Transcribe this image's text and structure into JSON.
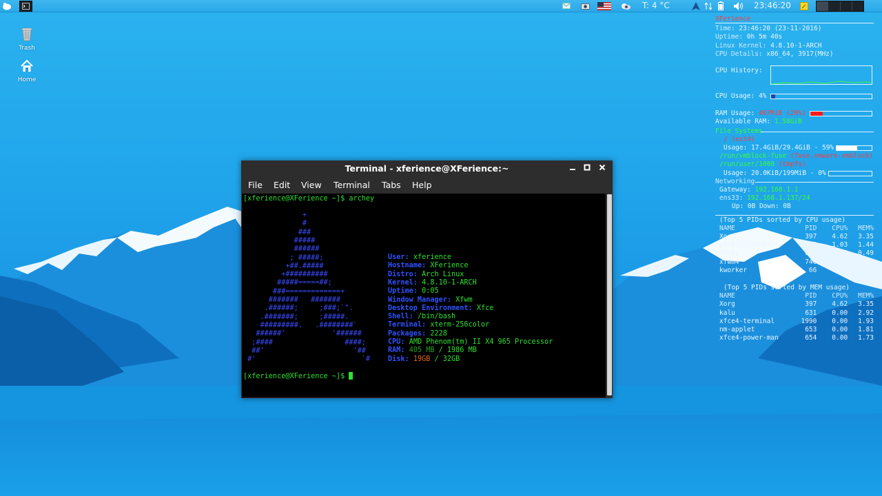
{
  "panel": {
    "temperature": "T: 4 °C",
    "clock": "23:46:20"
  },
  "desktop": {
    "icons": [
      {
        "label": "Trash",
        "icon": "trash-icon"
      },
      {
        "label": "Home",
        "icon": "home-icon"
      }
    ]
  },
  "conky": {
    "header": "XFerience",
    "time_label": "Time:",
    "time_value": "23:46:20 (23-11-2016)",
    "uptime_label": "Uptime:",
    "uptime_value": "0h 5m 40s",
    "kernel_label": "Linux Kernel:",
    "kernel_value": "4.8.10-1-ARCH",
    "cpu_details_label": "CPU Details:",
    "cpu_details_value": "x86_64, 3917(MHz)",
    "cpu_history_label": "CPU History:",
    "cpu_usage_label": "CPU Usage:",
    "cpu_usage_value": "4%",
    "cpu_usage_fraction": 0.04,
    "ram_usage_label": "RAM Usage:",
    "ram_usage_value": "407MiB (20%)",
    "ram_usage_fraction": 0.2,
    "available_ram_label": "Available RAM:",
    "available_ram_value": "1.58GiB",
    "fs_header": "File Systems",
    "fs_root": "/ (ext4)",
    "fs_root_usage": "Usage: 17.4GiB/29.4GiB - 59%",
    "fs_root_fraction": 0.59,
    "fs_vmblock": "/run/vmblock-fuse",
    "fs_vmblock_type": "(fuse.vmware-vmblock)",
    "fs_run_user": "/run/user/1000",
    "fs_run_user_type": "(tmpfs)",
    "fs_run_user_usage": "Usage: 20.0KiB/199MiB - 0%",
    "fs_run_user_fraction": 0.0,
    "net_header": "Networking",
    "gateway_label": "Gateway:",
    "gateway_value": "192.168.1.1",
    "ens_label": "ens33:",
    "ens_value": "192.168.1.137/24",
    "updown": "Up: 0B    Down: 0B",
    "cpu_top_header": "(Top 5 PIDs sorted by CPU usage)",
    "mem_top_header": "(Top 5 PIDs sorted by MEM usage)",
    "cols": {
      "name": "NAME",
      "pid": "PID",
      "cpu": "CPU%",
      "mem": "MEM%"
    },
    "cpu_top": [
      {
        "name": "Xorg",
        "pid": "397",
        "cpu": "4.62",
        "mem": "3.35"
      },
      {
        "name": "panel-weather",
        "pid": "770",
        "cpu": "1.03",
        "mem": "1.44"
      },
      {
        "name": "conky",
        "pid": "869",
        "cpu": "1.03",
        "mem": "0.49"
      },
      {
        "name": "xfwm4",
        "pid": "746",
        "cpu": "0.77",
        "mem": "1.16"
      },
      {
        "name": "kworker",
        "pid": "66",
        "cpu": "0.26",
        "mem": "0.00"
      }
    ],
    "mem_top": [
      {
        "name": "Xorg",
        "pid": "397",
        "cpu": "4.62",
        "mem": "3.35"
      },
      {
        "name": "kalu",
        "pid": "631",
        "cpu": "0.00",
        "mem": "2.92"
      },
      {
        "name": "xfce4-terminal",
        "pid": "1990",
        "cpu": "0.00",
        "mem": "1.93"
      },
      {
        "name": "nm-applet",
        "pid": "653",
        "cpu": "0.00",
        "mem": "1.81"
      },
      {
        "name": "xfce4-power-man",
        "pid": "654",
        "cpu": "0.00",
        "mem": "1.73"
      }
    ]
  },
  "terminal": {
    "title": "Terminal - xferience@XFerience:~",
    "menu": [
      "File",
      "Edit",
      "View",
      "Terminal",
      "Tabs",
      "Help"
    ],
    "prompt": "[xferience@XFerience ~]$",
    "command": "archey",
    "logo_lines": [
      "              +",
      "              #",
      "             ###",
      "            #####",
      "            ######",
      "           ; #####;",
      "          +##.#####",
      "         +##########",
      "        #####=====##;",
      "       ###=============+",
      "      #######   #######",
      "     .######;     ;###;`\".",
      "    .#######;     ;#####.",
      "    #########.   .########`",
      "   ######'           '######",
      "  ;####                 ####;",
      "  ##'                     '##",
      " #'                         `#"
    ],
    "info": [
      {
        "label": "User:",
        "value": "xferience"
      },
      {
        "label": "Hostname:",
        "value": "XFerience"
      },
      {
        "label": "Distro:",
        "value": "Arch Linux"
      },
      {
        "label": "Kernel:",
        "value": "4.8.10-1-ARCH"
      },
      {
        "label": "Uptime:",
        "value": "0:05"
      },
      {
        "label": "Window Manager:",
        "value": "Xfwm"
      },
      {
        "label": "Desktop Environment:",
        "value": "Xfce"
      },
      {
        "label": "Shell:",
        "value": "/bin/bash"
      },
      {
        "label": "Terminal:",
        "value": "xterm-256color"
      },
      {
        "label": "Packages:",
        "value": "2228"
      },
      {
        "label": "CPU:",
        "value": "AMD Phenom(tm) II X4 965 Processor"
      }
    ],
    "ram": {
      "label": "RAM:",
      "used": "405 MB",
      "sep": " / ",
      "total": "1986 MB"
    },
    "disk": {
      "label": "Disk:",
      "used": "19GB",
      "sep": " / ",
      "total": "32GB"
    }
  }
}
